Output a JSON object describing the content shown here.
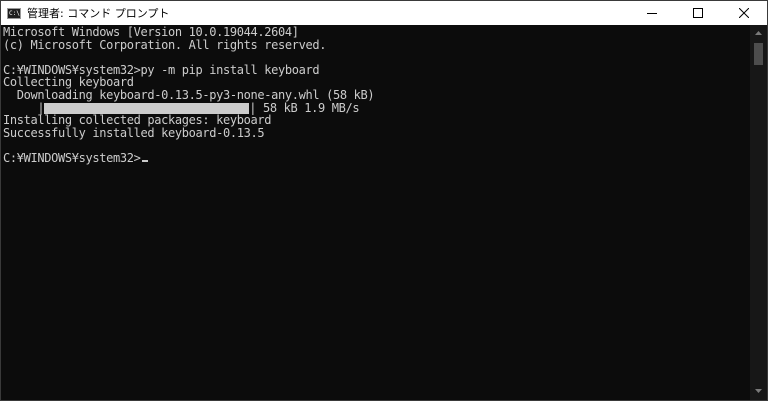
{
  "window": {
    "title": "管理者: コマンド プロンプト",
    "icon_glyph": "C:\\",
    "icon": "cmd-icon"
  },
  "caption": {
    "minimize_icon": "minimize-icon",
    "maximize_icon": "maximize-icon",
    "close_icon": "close-icon"
  },
  "console": {
    "lines": [
      "Microsoft Windows [Version 10.0.19044.2604]",
      "(c) Microsoft Corporation. All rights reserved.",
      "",
      "C:¥WINDOWS¥system32>py -m pip install keyboard",
      "Collecting keyboard",
      "  Downloading keyboard-0.13.5-py3-none-any.whl (58 kB)"
    ],
    "progress": {
      "prefix": "     |",
      "suffix": "| 58 kB 1.9 MB/s",
      "fraction": 1.0
    },
    "lines_after": [
      "Installing collected packages: keyboard",
      "Successfully installed keyboard-0.13.5",
      ""
    ],
    "prompt": "C:¥WINDOWS¥system32>"
  },
  "colors": {
    "background": "#0c0c0c",
    "foreground": "#cccccc",
    "titlebar": "#ffffff"
  }
}
